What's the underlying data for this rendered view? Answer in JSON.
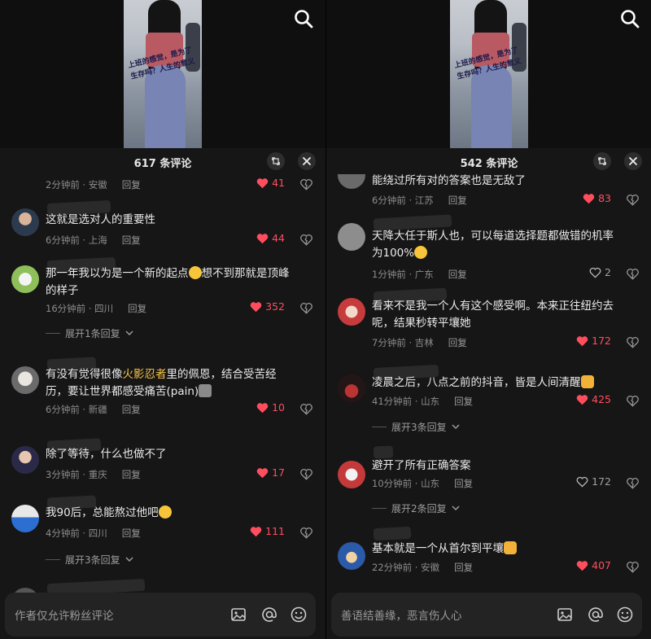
{
  "left": {
    "video_caption": "上班的感觉，是为了生存吗？人生的意义",
    "header_title": "617 条评论",
    "input_placeholder": "作者仅允许粉丝评论",
    "comments": [
      {
        "text": "",
        "time": "2分钟前 · 安徽",
        "reply": "回复",
        "likes": "41",
        "liked": true
      },
      {
        "text": "这就是选对人的重要性",
        "time": "6分钟前 · 上海",
        "reply": "回复",
        "likes": "44",
        "liked": true
      },
      {
        "text_a": "那一年我以为是一个新的起点",
        "text_b": "想不到那就是顶峰的样子",
        "time": "16分钟前 · 四川",
        "reply": "回复",
        "likes": "352",
        "liked": true,
        "expand": "展开1条回复"
      },
      {
        "text_a": "有没有觉得很像",
        "highlight": "火影忍者",
        "text_b": "里的佩恩，结合受苦经历，要让世界都感受痛苦(pain)",
        "time": "6分钟前 · 新疆",
        "reply": "回复",
        "likes": "10",
        "liked": true
      },
      {
        "text": "除了等待，什么也做不了",
        "time": "3分钟前 · 重庆",
        "reply": "回复",
        "likes": "17",
        "liked": true
      },
      {
        "text": "我90后，总能熬过他吧",
        "time": "4分钟前 · 四川",
        "reply": "回复",
        "likes": "111",
        "liked": true,
        "expand": "展开3条回复"
      }
    ]
  },
  "right": {
    "video_caption": "上班的感觉，是为了生存吗？人生的意义",
    "header_title": "542 条评论",
    "input_placeholder": "善语结善缘，恶言伤人心",
    "comments": [
      {
        "text": "能绕过所有对的答案也是无敌了",
        "time": "6分钟前 · 江苏",
        "reply": "回复",
        "likes": "83",
        "liked": true
      },
      {
        "text": "天降大任于斯人也，可以每道选择题都做错的机率为100%",
        "time": "1分钟前 · 广东",
        "reply": "回复",
        "likes": "2",
        "liked": false
      },
      {
        "text": "看来不是我一个人有这个感受啊。本来正往纽约去呢，结果秒转平壤她",
        "time": "7分钟前 · 吉林",
        "reply": "回复",
        "likes": "172",
        "liked": true
      },
      {
        "text": "凌晨之后，八点之前的抖音，皆是人间清醒",
        "time": "41分钟前 · 山东",
        "reply": "回复",
        "likes": "425",
        "liked": true,
        "expand": "展开3条回复"
      },
      {
        "text": "避开了所有正确答案",
        "time": "10分钟前 · 山东",
        "reply": "回复",
        "likes": "172",
        "liked": false,
        "expand": "展开2条回复"
      },
      {
        "text": "基本就是一个从首尔到平壤",
        "time": "22分钟前 · 安徽",
        "reply": "回复",
        "likes": "407",
        "liked": true
      }
    ]
  },
  "colors": {
    "accent_red": "#ff4d5e",
    "highlight_yellow": "#f5c249",
    "sheet_bg": "#161616"
  }
}
